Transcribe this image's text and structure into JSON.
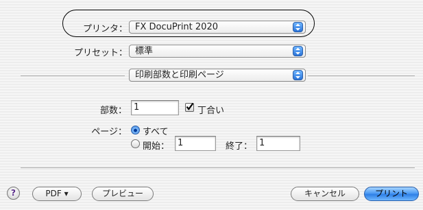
{
  "form": {
    "printer_label": "プリンタ：",
    "printer_value": "FX DocuPrint 2020",
    "preset_label": "プリセット：",
    "preset_value": "標準",
    "pane_value": "印刷部数と印刷ページ",
    "copies_label": "部数：",
    "copies_value": "1",
    "collate_label": "丁合い",
    "collate_checked": true,
    "pages_label": "ページ：",
    "pages_all_label": "すべて",
    "pages_all_selected": true,
    "pages_from_label": "開始：",
    "pages_from_value": "1",
    "pages_to_label": "終了：",
    "pages_to_value": "1"
  },
  "footer": {
    "help_label": "?",
    "pdf_label": "PDF ▾",
    "preview_label": "プレビュー",
    "cancel_label": "キャンセル",
    "print_label": "プリント"
  },
  "icons": {
    "popup_arrows": "up-down-arrows-icon",
    "checkmark": "checkmark-icon"
  },
  "colors": {
    "accent": "#2f80e6",
    "highlight_outline": "#000000"
  }
}
